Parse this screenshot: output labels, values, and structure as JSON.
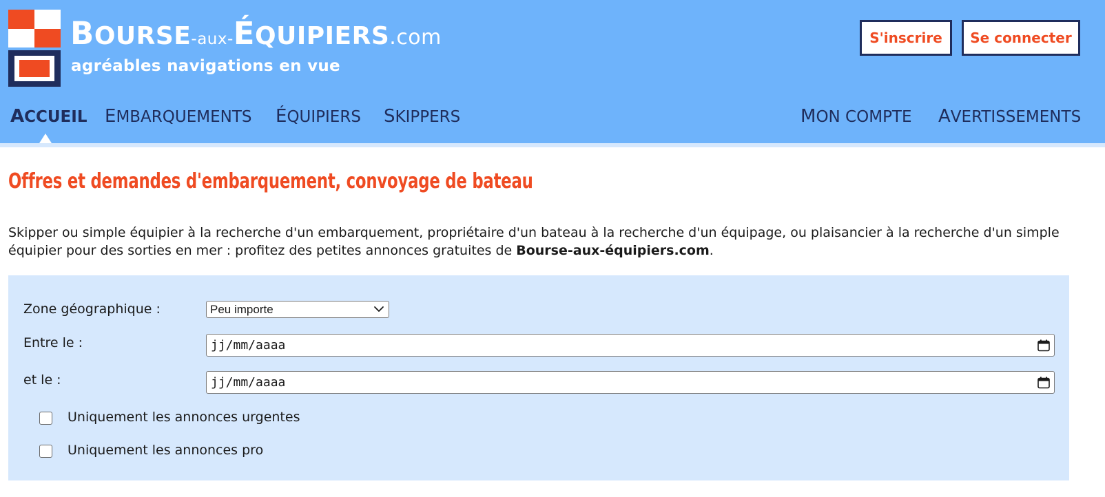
{
  "colors": {
    "header_bg": "#6eb3fb",
    "accent": "#ef4b22",
    "navy": "#1f2d5c",
    "panel_bg": "#d6e8fd"
  },
  "brand": {
    "part1_initial": "B",
    "part1_rest": "OURSE",
    "part2": "-aux-",
    "part3_initial": "É",
    "part3_rest": "QUIPIERS",
    "part4": ".com",
    "tagline": "agréables navigations en vue"
  },
  "header": {
    "register_label": "S'inscrire",
    "login_label": "Se connecter"
  },
  "nav": {
    "home": {
      "initial": "A",
      "rest": "CCUEIL"
    },
    "embarkations": {
      "initial": "E",
      "rest": "MBARQUEMENTS"
    },
    "crew": {
      "initial": "É",
      "rest": "QUIPIERS"
    },
    "skippers": {
      "initial": "S",
      "rest": "KIPPERS"
    },
    "account": {
      "initial": "M",
      "rest": "ON COMPTE"
    },
    "alerts": {
      "initial": "A",
      "rest": "VERTISSEMENTS"
    }
  },
  "main": {
    "title": "Offres et demandes d'embarquement, convoyage de bateau",
    "intro_text": "Skipper ou simple équipier à la recherche d'un embarquement, propriétaire d'un bateau à la recherche d'un équipage, ou plaisancier à la recherche d'un simple équipier pour des sorties en mer : profitez des petites annonces gratuites de ",
    "intro_bold": "Bourse-aux-équipiers.com",
    "intro_end": "."
  },
  "form": {
    "zone_label": "Zone géographique :",
    "zone_value": "Peu importe",
    "from_label": "Entre le :",
    "from_placeholder": "jj/mm/aaaa",
    "to_label": "et le :",
    "to_placeholder": "jj/mm/aaaa",
    "urgent_label": "Uniquement les annonces urgentes",
    "urgent_checked": false,
    "pro_label": "Uniquement les annonces pro",
    "pro_checked": false
  },
  "icons": {
    "select_arrow": "chevron-down-icon",
    "date_picker": "calendar-icon"
  }
}
